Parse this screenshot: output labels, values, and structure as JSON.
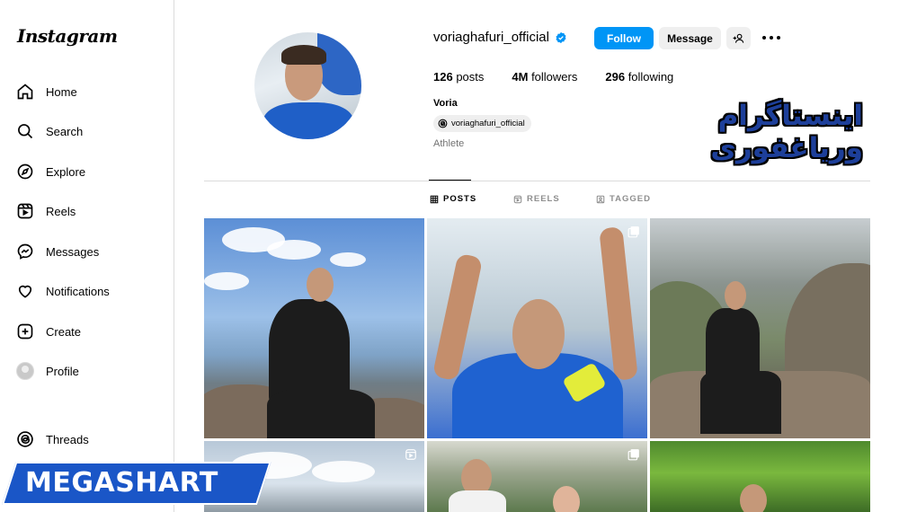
{
  "sidebar": {
    "logo": "Instagram",
    "items": [
      {
        "label": "Home",
        "icon": "home-icon"
      },
      {
        "label": "Search",
        "icon": "search-icon"
      },
      {
        "label": "Explore",
        "icon": "compass-icon"
      },
      {
        "label": "Reels",
        "icon": "reels-icon"
      },
      {
        "label": "Messages",
        "icon": "messenger-icon"
      },
      {
        "label": "Notifications",
        "icon": "heart-icon"
      },
      {
        "label": "Create",
        "icon": "plus-square-icon"
      },
      {
        "label": "Profile",
        "icon": "avatar"
      },
      {
        "label": "Threads",
        "icon": "threads-icon"
      }
    ]
  },
  "profile": {
    "username": "voriaghafuri_official",
    "verified": true,
    "follow_label": "Follow",
    "message_label": "Message",
    "stats": {
      "posts_count": "126",
      "posts_label": " posts",
      "followers_count": "4M",
      "followers_label": " followers",
      "following_count": "296",
      "following_label": " following"
    },
    "display_name": "Voria",
    "threads_handle": "voriaghafuri_official",
    "category": "Athlete"
  },
  "overlay_text": "اینستاگرام وریاغفوری",
  "tabs": [
    {
      "label": "POSTS",
      "icon": "grid-icon",
      "active": true
    },
    {
      "label": "REELS",
      "icon": "reels-icon",
      "active": false
    },
    {
      "label": "TAGGED",
      "icon": "tag-icon",
      "active": false
    }
  ],
  "watermark": "MEGASHART",
  "colors": {
    "accent": "#0095f6",
    "verified": "#0095f6",
    "overlay_text": "#1d3f9a",
    "watermark_bg": "#1a56c7"
  }
}
